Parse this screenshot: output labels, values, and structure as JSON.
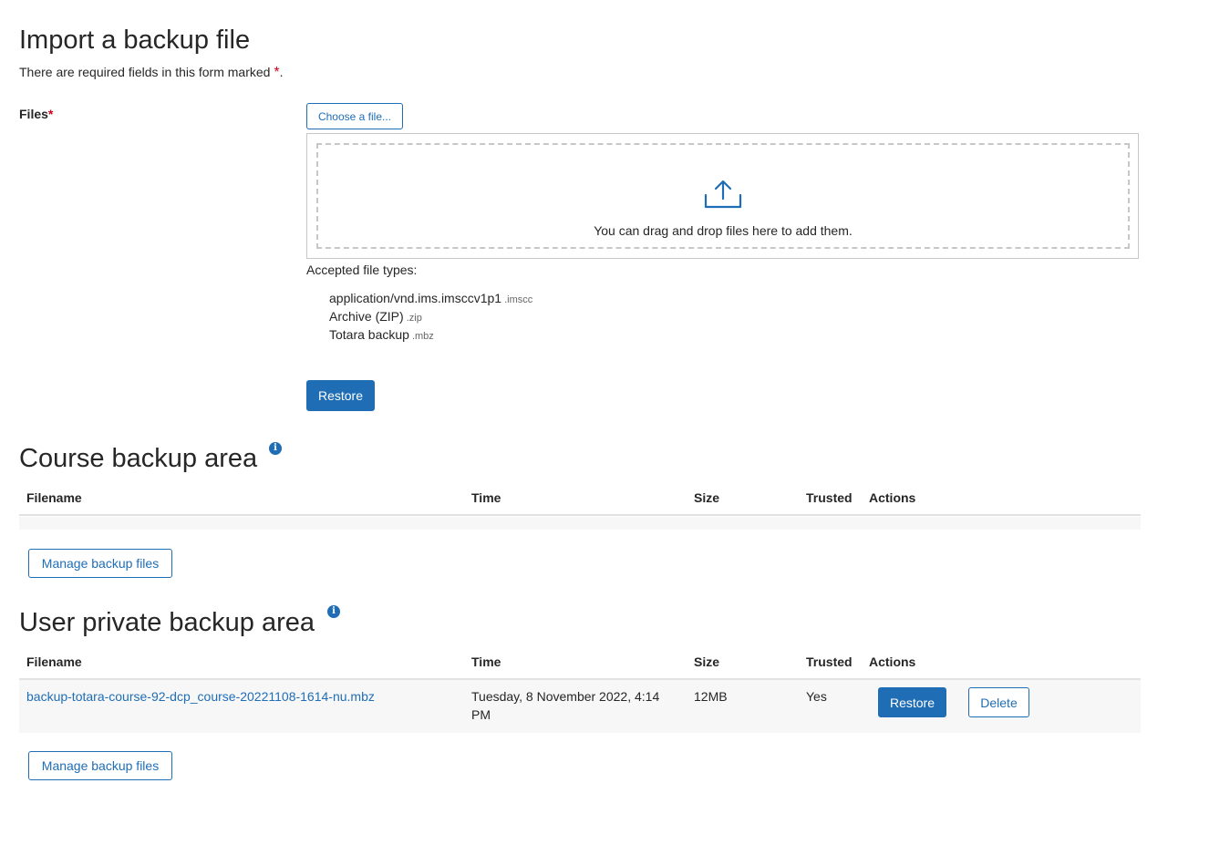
{
  "import": {
    "title": "Import a backup file",
    "required_note": "There are required fields in this form marked",
    "required_star": "*",
    "required_period": ".",
    "files_label": "Files",
    "choose_file_label": "Choose a file...",
    "drop_text": "You can drag and drop files here to add them.",
    "accepted_label": "Accepted file types:",
    "file_types": [
      {
        "name": "application/vnd.ims.imsccv1p1",
        "ext": ".imscc"
      },
      {
        "name": "Archive (ZIP)",
        "ext": ".zip"
      },
      {
        "name": "Totara backup",
        "ext": ".mbz"
      }
    ],
    "restore_label": "Restore"
  },
  "course_area": {
    "title": "Course backup area",
    "info_icon": "i",
    "columns": [
      "Filename",
      "Time",
      "Size",
      "Trusted",
      "Actions"
    ],
    "rows": [],
    "manage_label": "Manage backup files"
  },
  "user_area": {
    "title": "User private backup area",
    "info_icon": "i",
    "columns": [
      "Filename",
      "Time",
      "Size",
      "Trusted",
      "Actions"
    ],
    "rows": [
      {
        "filename": "backup-totara-course-92-dcp_course-20221108-1614-nu.mbz",
        "time_line1": "Tuesday, 8 November 2022, 4:14",
        "time_line2": "PM",
        "size": "12MB",
        "trusted": "Yes",
        "restore_label": "Restore",
        "delete_label": "Delete"
      }
    ],
    "manage_label": "Manage backup files"
  },
  "colors": {
    "accent": "#1f6db5",
    "required": "#d0021b",
    "border": "#c7c7c7",
    "row_bg": "#f7f7f7"
  }
}
